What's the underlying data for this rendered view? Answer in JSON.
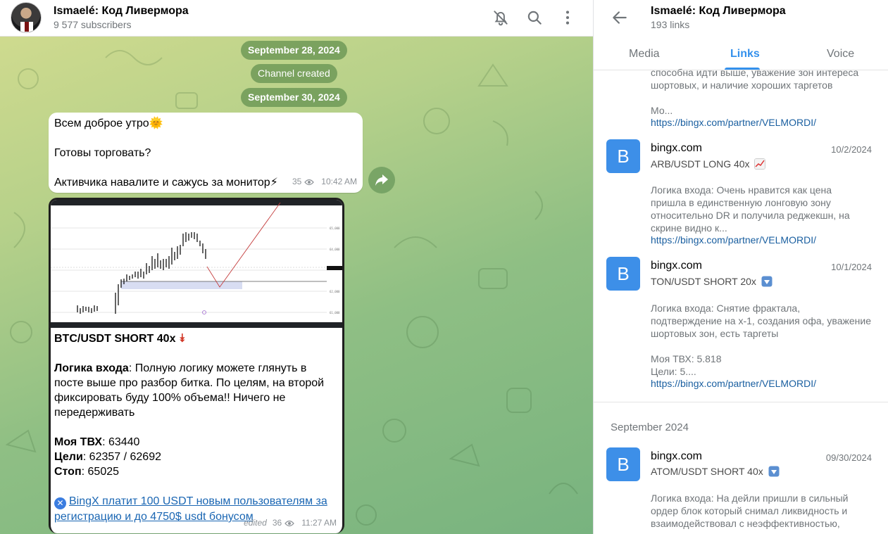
{
  "channel": {
    "title": "Ismaelé: Код Ливермора",
    "subscribers": "9 577 subscribers"
  },
  "chat": {
    "date1": "September 28, 2024",
    "service": "Channel created",
    "date2": "September 30, 2024",
    "msg1": {
      "line1": "Всем доброе утро",
      "line2": "Готовы торговать?",
      "line3": "Активчика навалите и сажусь за монитор",
      "views": "35",
      "time": "10:42 AM"
    },
    "msg2": {
      "heading": "BTC/USDT SHORT 40x",
      "logic_label": "Логика входа",
      "logic_text": ": Полную логику можете глянуть в посте выше про разбор битка. По целям, на второй фиксировать буду 100% объема!! Ничего не передерживать",
      "entry_label": "Моя ТВХ",
      "entry_value": ": 63440",
      "targets_label": "Цели",
      "targets_value": ": 62357 / 62692",
      "stop_label": "Стоп",
      "stop_value": ": 65025",
      "promo_link": "BingX платит 100 USDT новым пользователям за регистрацию и до 4750$ usdt бонусом",
      "edited": "edited",
      "views": "36",
      "time": "11:27 AM"
    }
  },
  "panel": {
    "title": "Ismaelé: Код Ливермора",
    "subtitle": "193 links",
    "tabs": [
      "Media",
      "Links",
      "Voice"
    ],
    "active_tab": "Links",
    "top_partial": {
      "text1": "способна идти выше, уважение зон интереса",
      "text2": "шортовых, и наличие хороших таргетов",
      "text3": "Мо...",
      "link": "https://bingx.com/partner/VELMORDI/"
    },
    "links": [
      {
        "letter": "B",
        "domain": "bingx.com",
        "date": "10/2/2024",
        "title": "ARB/USDT LONG 40x",
        "icon": "chart-up-icon",
        "desc": [
          "Логика входа: Очень нравится как цена",
          "пришла в единственную лонговую зону",
          "относительно DR и получила реджекшн, на",
          "скрине видно к..."
        ],
        "link": "https://bingx.com/partner/VELMORDI/"
      },
      {
        "letter": "B",
        "domain": "bingx.com",
        "date": "10/1/2024",
        "title": "TON/USDT SHORT 20x",
        "icon": "down-arrow-box-icon",
        "desc": [
          "Логика входа: Снятие фрактала,",
          "подтверждение на х-1, создания офа, уважение",
          "шортовых зон, есть таргеты",
          "",
          "Моя ТВХ: 5.818",
          "Цели: 5...."
        ],
        "link": "https://bingx.com/partner/VELMORDI/"
      }
    ],
    "month": "September 2024",
    "sept_link": {
      "letter": "B",
      "domain": "bingx.com",
      "date": "09/30/2024",
      "title": "ATOM/USDT SHORT 40x",
      "icon": "down-arrow-box-icon",
      "desc": [
        "Логика входа: На дейли пришли в сильный",
        "ордер блок который снимал ликвидность и",
        "взаимодействовал с неэффективностью,"
      ]
    }
  },
  "colors": {
    "accent": "#3390ec",
    "link": "#1a5fa0",
    "link_badge": "#3d8fe8",
    "chat_bg": "#a6c985"
  }
}
